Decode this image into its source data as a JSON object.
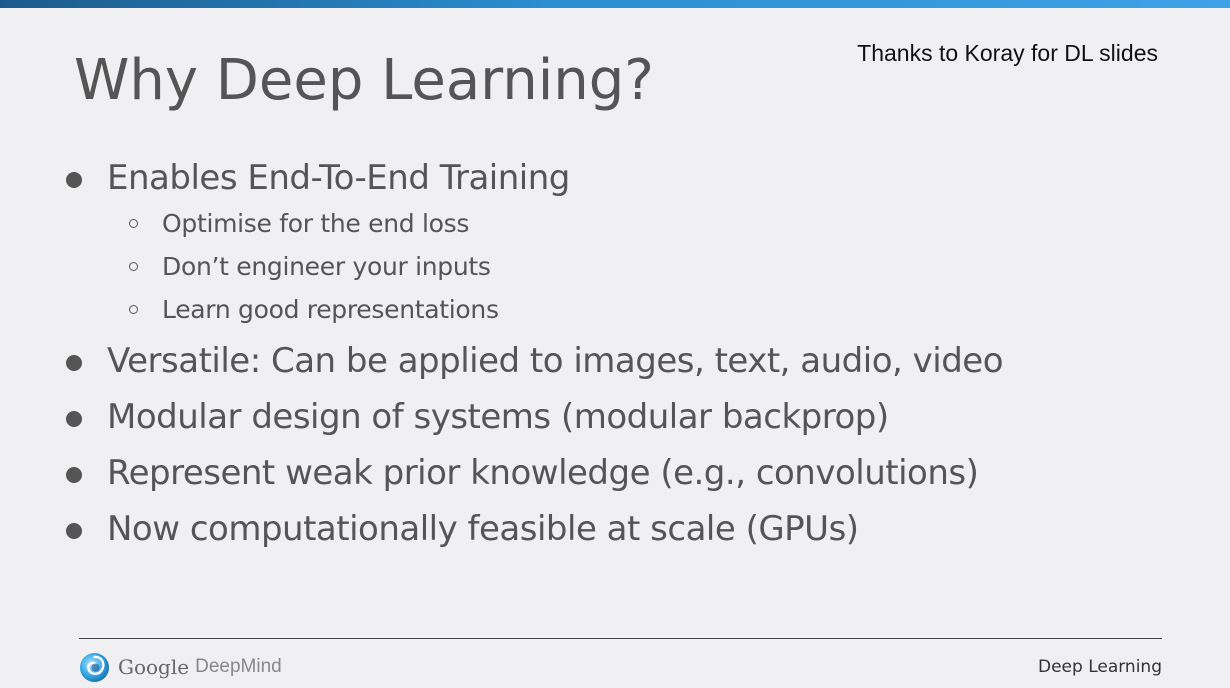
{
  "header": {
    "credit": "Thanks to Koray for DL slides",
    "title": "Why Deep Learning?"
  },
  "bullets": [
    {
      "text": "Enables End-To-End Training",
      "subitems": [
        "Optimise for the end loss",
        "Don’t engineer your inputs",
        "Learn good representations"
      ]
    },
    {
      "text": "Versatile: Can be applied to images, text, audio, video"
    },
    {
      "text": "Modular design of systems (modular backprop)"
    },
    {
      "text": "Represent weak prior knowledge (e.g., convolutions)"
    },
    {
      "text": "Now computationally feasible at scale (GPUs)"
    }
  ],
  "footer": {
    "logo_google": "Google",
    "logo_deepmind": "DeepMind",
    "logo_icon": "deepmind-swirl-icon",
    "course": "Deep Learning"
  },
  "colors": {
    "accent_bar": "#2a8fd0",
    "text": "#555555",
    "background": "#f0eff1"
  }
}
